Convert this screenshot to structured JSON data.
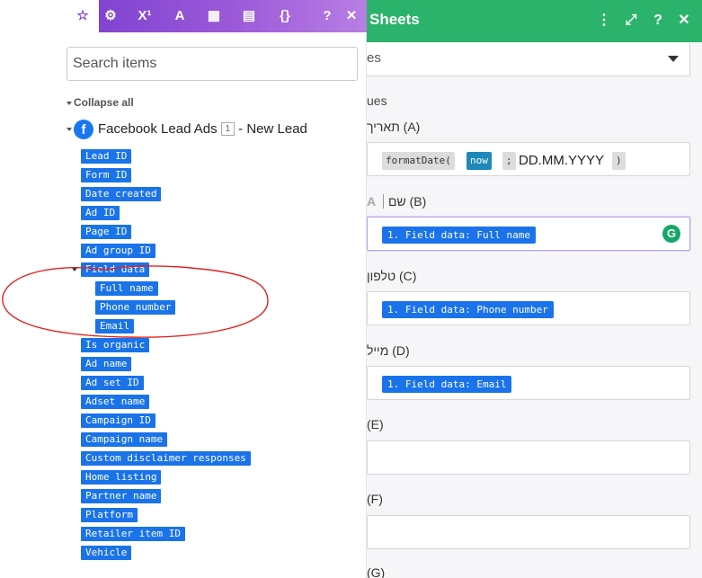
{
  "right_panel": {
    "title": "Sheets",
    "header_icons": [
      "⋮",
      "⤢",
      "?",
      "✕"
    ],
    "select_value": "es",
    "section_label": "ues",
    "fields": [
      {
        "label": "תאריך (A)",
        "type": "formula",
        "fn_name": "formatDate(",
        "fn_arg": "now",
        "fn_sep": ";",
        "fn_text": "DD.MM.YYYY",
        "fn_close": ")"
      },
      {
        "label": "שם (B)",
        "prefix_icon": "A",
        "value": "1. Field data: Full name",
        "focused": true,
        "grammarly": "G"
      },
      {
        "label": "טלפון (C)",
        "value": "1. Field data: Phone number"
      },
      {
        "label": "מייל (D)",
        "value": "1. Field data: Email"
      },
      {
        "label": "(E)",
        "value": ""
      },
      {
        "label": "(F)",
        "value": ""
      },
      {
        "label": "(G)",
        "value": ""
      }
    ]
  },
  "left_panel": {
    "tabs": [
      {
        "icon": "star-icon",
        "glyph": "☆",
        "active": true
      },
      {
        "icon": "gear-icon",
        "glyph": "⚙"
      },
      {
        "icon": "superscript-icon",
        "glyph": "X¹"
      },
      {
        "icon": "text-icon",
        "glyph": "A"
      },
      {
        "icon": "calendar-icon",
        "glyph": "▦"
      },
      {
        "icon": "table-icon",
        "glyph": "▤"
      },
      {
        "icon": "braces-icon",
        "glyph": "{}"
      },
      {
        "icon": "help-icon",
        "glyph": "?"
      },
      {
        "icon": "close-icon",
        "glyph": "✕"
      }
    ],
    "search_placeholder": "Search items",
    "collapse_label": "Collapse all",
    "module": {
      "name": "Facebook Lead Ads",
      "badge": "1",
      "suffix": "- New Lead"
    },
    "items": [
      "Lead ID",
      "Form ID",
      "Date created",
      "Ad ID",
      "Page ID",
      "Ad group ID",
      "Field data",
      "Full name",
      "Phone number",
      "Email",
      "Is organic",
      "Ad name",
      "Ad set ID",
      "Adset name",
      "Campaign ID",
      "Campaign name",
      "Custom disclaimer responses",
      "Home listing",
      "Partner name",
      "Platform",
      "Retailer item ID",
      "Vehicle"
    ]
  },
  "colors": {
    "green_header": "#2cb36b",
    "purple_header": "#7b3fd0",
    "pill_blue": "#1a73e8",
    "annotation": "#e02020"
  }
}
